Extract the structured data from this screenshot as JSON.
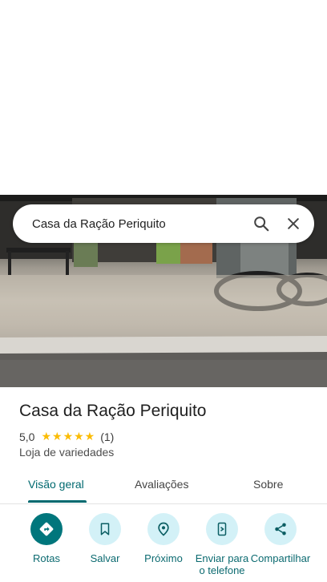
{
  "search": {
    "query": "Casa da Ração Periquito"
  },
  "place": {
    "name": "Casa da Ração Periquito",
    "rating": "5,0",
    "stars": "★★★★★",
    "review_count": "(1)",
    "category": "Loja de variedades"
  },
  "tabs": [
    {
      "label": "Visão geral",
      "active": true
    },
    {
      "label": "Avaliações"
    },
    {
      "label": "Sobre"
    }
  ],
  "actions": [
    {
      "label": "Rotas",
      "icon": "directions-icon"
    },
    {
      "label": "Salvar",
      "icon": "bookmark-icon"
    },
    {
      "label": "Próximo",
      "icon": "nearby-icon"
    },
    {
      "label": "Enviar para o telefone",
      "icon": "send-to-phone-icon"
    },
    {
      "label": "Compartilhar",
      "icon": "share-icon"
    }
  ],
  "colors": {
    "accent": "#00696f",
    "action_bg": "#d3f1f7",
    "star": "#fbbc04"
  }
}
